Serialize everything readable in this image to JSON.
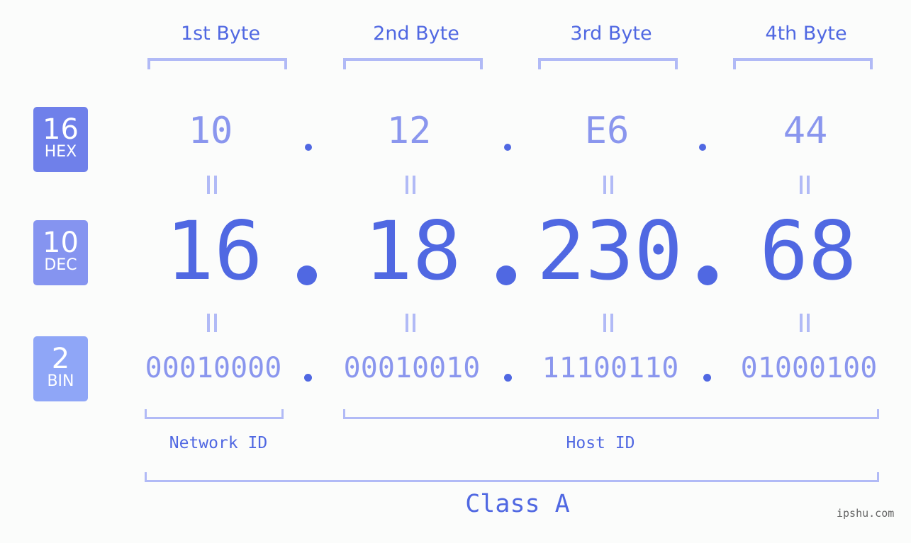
{
  "bases": [
    {
      "num": "16",
      "label": "HEX",
      "color": "#6f80ea"
    },
    {
      "num": "10",
      "label": "DEC",
      "color": "#8594f0"
    },
    {
      "num": "2",
      "label": "BIN",
      "color": "#8fa6f7"
    }
  ],
  "byte_headers": [
    "1st Byte",
    "2nd Byte",
    "3rd Byte",
    "4th Byte"
  ],
  "hex": [
    "10",
    "12",
    "E6",
    "44"
  ],
  "dec": [
    "16",
    "18",
    "230",
    "68"
  ],
  "bin": [
    "00010000",
    "00010010",
    "11100110",
    "01000100"
  ],
  "network_id_label": "Network ID",
  "host_id_label": "Host ID",
  "class_label": "Class A",
  "watermark": "ipshu.com",
  "colors": {
    "accent": "#5068e2",
    "light": "#8a96ee",
    "bracket": "#b1baf6"
  }
}
